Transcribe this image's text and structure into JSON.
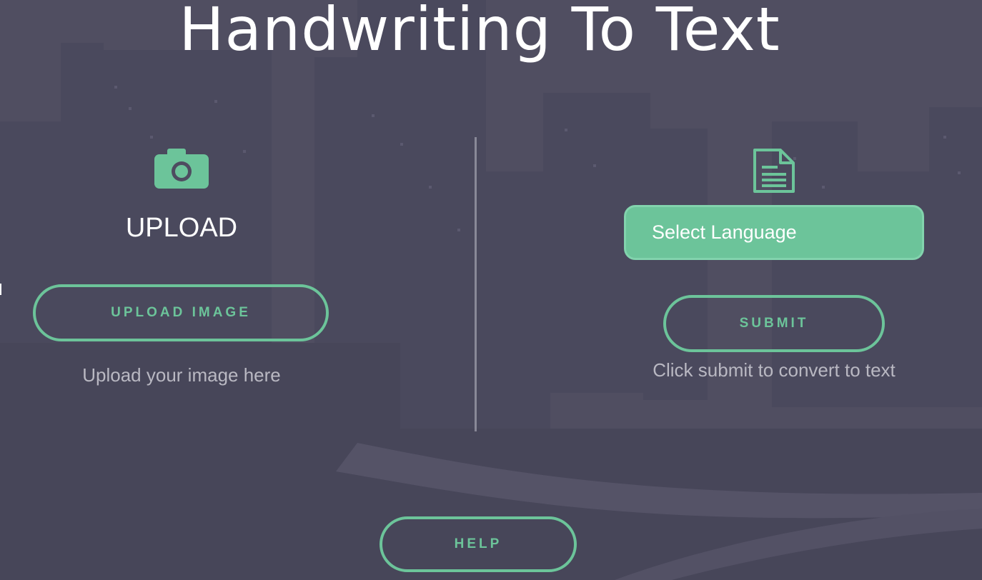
{
  "page": {
    "title": "Handwriting To Text"
  },
  "upload": {
    "heading": "UPLOAD",
    "button_label": "UPLOAD IMAGE",
    "caption": "Upload your image here",
    "icon": "camera-icon"
  },
  "convert": {
    "icon": "document-icon",
    "select_label": "Select Language",
    "submit_label": "SUBMIT",
    "caption": "Click submit to convert to text"
  },
  "footer": {
    "help_label": "HELP"
  },
  "colors": {
    "accent": "#6cc49a",
    "background": "#4d4b5c",
    "text": "#ffffff",
    "caption": "#b9b8c2"
  }
}
